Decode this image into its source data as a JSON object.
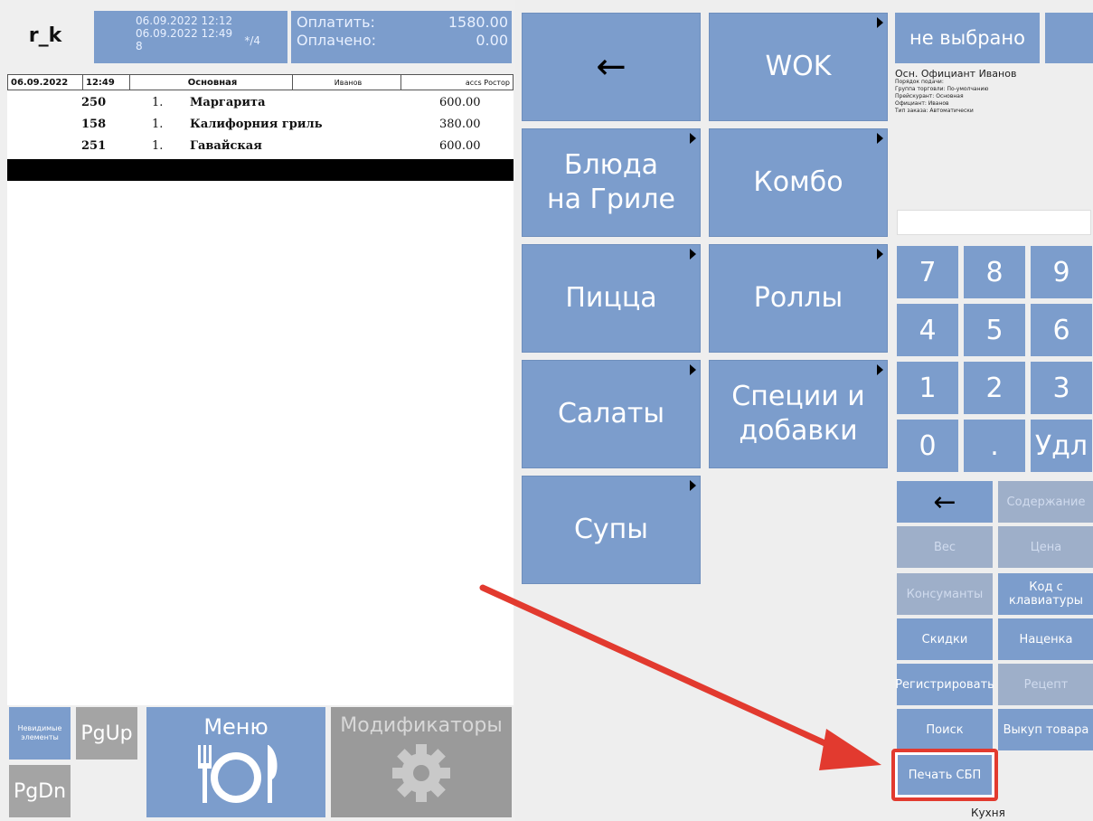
{
  "header": {
    "logo": "r_k",
    "datetime_open": "06.09.2022 12:12",
    "datetime_now": "06.09.2022 12:49",
    "guests": "8",
    "table": "*/4",
    "pay_label": "Оплатить:",
    "pay_value": "1580.00",
    "paid_label": "Оплачено:",
    "paid_value": "0.00"
  },
  "order": {
    "header": {
      "date": "06.09.2022",
      "time": "12:49",
      "course": "Основная",
      "waiter": "Иванов",
      "rest": "ассs Ростор"
    },
    "items": [
      {
        "code": "250",
        "qty": "1.",
        "name": "Маргарита",
        "price": "600.00"
      },
      {
        "code": "158",
        "qty": "1.",
        "name": "Калифорния гриль",
        "price": "380.00"
      },
      {
        "code": "251",
        "qty": "1.",
        "name": "Гавайская",
        "price": "600.00"
      }
    ]
  },
  "bottom": {
    "invisible": "Невидимые элементы",
    "pgup": "PgUp",
    "pgdn": "PgDn",
    "menu": "Меню",
    "modifiers": "Модификаторы"
  },
  "categories": [
    {
      "label": "←"
    },
    {
      "label": "WOK"
    },
    {
      "label": "Блюда на Гриле"
    },
    {
      "label": "Комбо"
    },
    {
      "label": "Пицца"
    },
    {
      "label": "Роллы"
    },
    {
      "label": "Салаты"
    },
    {
      "label": "Специи и добавки"
    },
    {
      "label": "Супы"
    }
  ],
  "right": {
    "waiter_btn": "не выбрано",
    "info_main": "Осн. Официант  Иванов",
    "info_lines": [
      "Порядок подачи:",
      "Группа торговли: По-умолчанию",
      "Прейскурант: Основная",
      "Официант: Иванов",
      "Тип заказа: Автоматически"
    ],
    "numpad": [
      "7",
      "8",
      "9",
      "4",
      "5",
      "6",
      "1",
      "2",
      "3",
      "0",
      ".",
      "Удл"
    ],
    "arrow": "←",
    "func": {
      "content": "Содержание",
      "weight": "Вес",
      "price": "Цена",
      "consumants": "Консуманты",
      "kbd_code": "Код с клавиатуры",
      "discounts": "Скидки",
      "markup": "Наценка",
      "register": "Регистрировать",
      "recipe": "Рецепт",
      "search": "Поиск",
      "buyback": "Выкуп товара",
      "print_sbp": "Печать СБП"
    },
    "kitchen": "Кухня"
  },
  "colors": {
    "button_blue": "#7c9dcc",
    "highlight_red": "#e23a2f"
  }
}
